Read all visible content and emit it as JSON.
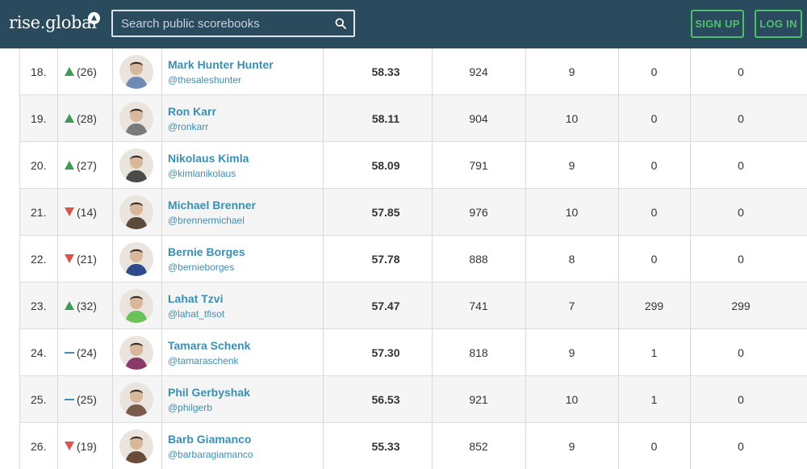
{
  "header": {
    "logo_text": "rise.global",
    "search_placeholder": "Search public scorebooks",
    "signup_label": "SIGN UP",
    "login_label": "LOG IN"
  },
  "colors": {
    "header_bg": "#2a4a5e",
    "accent_green": "#4ec06b",
    "link_blue": "#3b8fb3",
    "up_green": "#3f9a55",
    "down_red": "#d9534f",
    "same_blue": "#3b8fb3"
  },
  "rows": [
    {
      "rank": "18.",
      "trend": "up",
      "prev": "(26)",
      "name": "Mark Hunter Hunter",
      "handle": "@thesaleshunter",
      "score": "58.33",
      "c1": "924",
      "c2": "9",
      "c3": "0",
      "c4": "0",
      "avatar_color": "#6f8bb5"
    },
    {
      "rank": "19.",
      "trend": "up",
      "prev": "(28)",
      "name": "Ron Karr",
      "handle": "@ronkarr",
      "score": "58.11",
      "c1": "904",
      "c2": "10",
      "c3": "0",
      "c4": "0",
      "avatar_color": "#7a7a7a"
    },
    {
      "rank": "20.",
      "trend": "up",
      "prev": "(27)",
      "name": "Nikolaus Kimla",
      "handle": "@kimlanikolaus",
      "score": "58.09",
      "c1": "791",
      "c2": "9",
      "c3": "0",
      "c4": "0",
      "avatar_color": "#4a4a4a"
    },
    {
      "rank": "21.",
      "trend": "down",
      "prev": "(14)",
      "name": "Michael Brenner",
      "handle": "@brennermichael",
      "score": "57.85",
      "c1": "976",
      "c2": "10",
      "c3": "0",
      "c4": "0",
      "avatar_color": "#5b4a3a"
    },
    {
      "rank": "22.",
      "trend": "down",
      "prev": "(21)",
      "name": "Bernie Borges",
      "handle": "@bernieborges",
      "score": "57.78",
      "c1": "888",
      "c2": "8",
      "c3": "0",
      "c4": "0",
      "avatar_color": "#2d4a8a"
    },
    {
      "rank": "23.",
      "trend": "up",
      "prev": "(32)",
      "name": "Lahat Tzvi",
      "handle": "@lahat_tfisot",
      "score": "57.47",
      "c1": "741",
      "c2": "7",
      "c3": "299",
      "c4": "299",
      "avatar_color": "#6cc25a"
    },
    {
      "rank": "24.",
      "trend": "same",
      "prev": "(24)",
      "name": "Tamara Schenk",
      "handle": "@tamaraschenk",
      "score": "57.30",
      "c1": "818",
      "c2": "9",
      "c3": "1",
      "c4": "0",
      "avatar_color": "#8a3a6a"
    },
    {
      "rank": "25.",
      "trend": "same",
      "prev": "(25)",
      "name": "Phil Gerbyshak",
      "handle": "@philgerb",
      "score": "56.53",
      "c1": "921",
      "c2": "10",
      "c3": "1",
      "c4": "0",
      "avatar_color": "#7a5a4a"
    },
    {
      "rank": "26.",
      "trend": "down",
      "prev": "(19)",
      "name": "Barb Giamanco",
      "handle": "@barbaragiamanco",
      "score": "55.33",
      "c1": "852",
      "c2": "9",
      "c3": "0",
      "c4": "0",
      "avatar_color": "#6a4a3a"
    }
  ]
}
